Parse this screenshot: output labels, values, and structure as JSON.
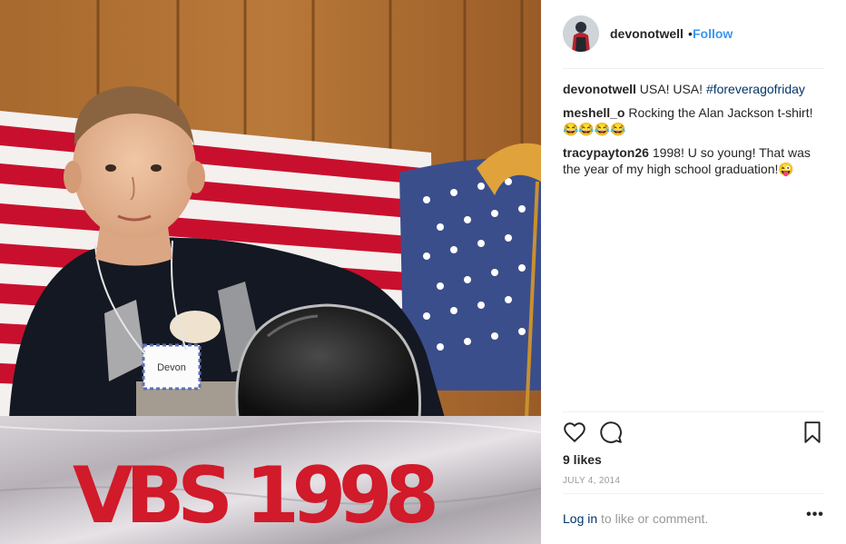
{
  "post": {
    "username": "devonotwell",
    "separator": "•",
    "follow_label": "Follow",
    "likes": "9 likes",
    "date": "JULY 4, 2014",
    "login_link": "Log in",
    "login_rest": " to like or comment.",
    "more_label": "•••"
  },
  "comments": [
    {
      "user": "devonotwell",
      "text": "USA! USA! ",
      "tag": "#foreveragofriday"
    },
    {
      "user": "meshell_o",
      "text": "Rocking the Alan Jackson t-shirt! 😂😂😂😂",
      "tag": ""
    },
    {
      "user": "tracypayton26",
      "text": "1998! U so young! That was the year of my high school graduation!😜",
      "tag": ""
    }
  ],
  "photo": {
    "sign_text": "VBS 1998",
    "name_tag": "Devon"
  },
  "colors": {
    "follow_blue": "#3897f0",
    "link_navy": "#003569",
    "muted_gray": "#999999",
    "flag_red": "#c8102e",
    "flag_blue": "#3b4e8c",
    "sign_red": "#d11a2a"
  },
  "icons": {
    "like": "heart-icon",
    "comment": "comment-bubble-icon",
    "save": "bookmark-icon",
    "more": "more-options-icon"
  }
}
